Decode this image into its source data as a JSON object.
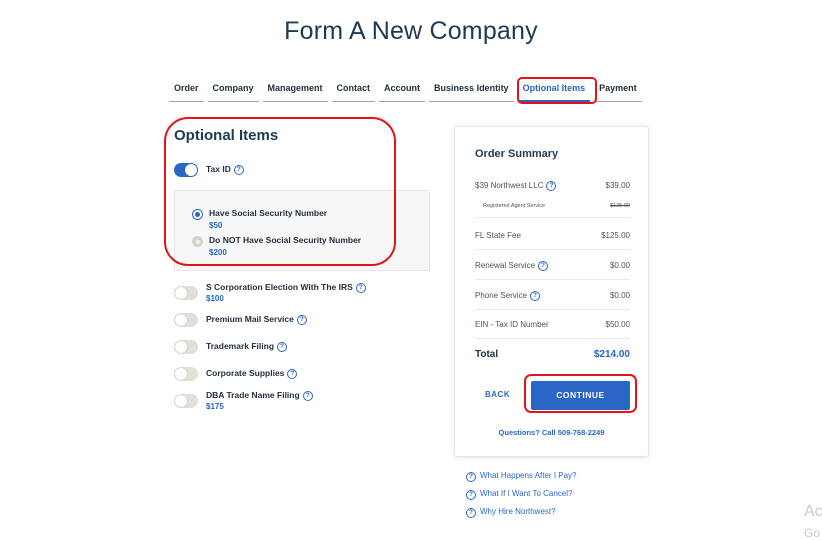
{
  "page": {
    "title": "Form A New Company"
  },
  "tabs": [
    {
      "label": "Order"
    },
    {
      "label": "Company"
    },
    {
      "label": "Management"
    },
    {
      "label": "Contact"
    },
    {
      "label": "Account"
    },
    {
      "label": "Business Identity"
    },
    {
      "label": "Optional Items",
      "active": true
    },
    {
      "label": "Payment"
    }
  ],
  "optional": {
    "title": "Optional Items",
    "tax_id": {
      "label": "Tax ID",
      "enabled": true
    },
    "ssn_options": [
      {
        "label": "Have Social Security Number",
        "price": "$50",
        "selected": true
      },
      {
        "label": "Do NOT Have Social Security Number",
        "price": "$200",
        "selected": false
      }
    ],
    "items": [
      {
        "label": "S Corporation Election With The IRS",
        "price": "$100",
        "enabled": false
      },
      {
        "label": "Premium Mail Service",
        "price": "",
        "enabled": false
      },
      {
        "label": "Trademark Filing",
        "price": "",
        "enabled": false
      },
      {
        "label": "Corporate Supplies",
        "price": "",
        "enabled": false
      },
      {
        "label": "DBA Trade Name Filing",
        "price": "$175",
        "enabled": false
      }
    ]
  },
  "summary": {
    "title": "Order Summary",
    "line1": {
      "label": "$39 Northwest LLC",
      "value": "$39.00"
    },
    "line1_sub": {
      "label": "Registered Agent Service",
      "value": "$125.00"
    },
    "rows": [
      {
        "label": "FL State Fee",
        "value": "$125.00"
      },
      {
        "label": "Renewal Service",
        "value": "$0.00"
      },
      {
        "label": "Phone Service",
        "value": "$0.00"
      },
      {
        "label": "EIN - Tax ID Number",
        "value": "$50.00"
      }
    ],
    "total": {
      "label": "Total",
      "value": "$214.00"
    },
    "back_label": "BACK",
    "continue_label": "CONTINUE",
    "questions": "Questions? Call 509-768-2249"
  },
  "faq": [
    {
      "label": "What Happens After I Pay?"
    },
    {
      "label": "What If I Want To Cancel?"
    },
    {
      "label": "Why Hire Northwest?"
    }
  ],
  "icons": {
    "help": "question-circle-icon"
  },
  "colors": {
    "accent": "#2a66c6",
    "highlight": "#e3131b",
    "heading": "#1e3a52"
  },
  "watermark": {
    "line1": "Ac",
    "line2": "Go"
  }
}
